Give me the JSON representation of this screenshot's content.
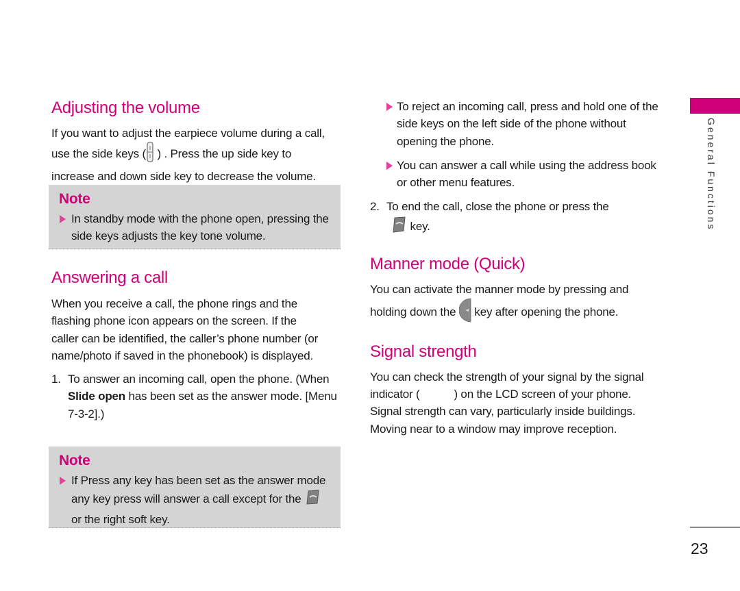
{
  "sections": {
    "volume": {
      "heading": "Adjusting the volume",
      "text_a": "If you want to adjust the earpiece volume during a call, use the side keys (",
      "text_b": ") . Press the up side key to increase and down side key to decrease the volume.",
      "note": {
        "title": "Note",
        "bullet": "In standby mode with the phone open, pressing the side keys adjusts the key tone volume."
      }
    },
    "answering": {
      "heading": "Answering a call",
      "text": "When you receive a call, the phone rings and the flashing phone icon appears on the screen. If the caller can be identified, the caller’s phone number (or name/photo if saved in the phonebook) is displayed.",
      "step1": {
        "number": "1.",
        "text_a": "To answer an incoming call, open the phone. (When ",
        "bold": "Slide open",
        "text_b": " has been set as the answer mode. [Menu 7-3-2].)"
      },
      "note": {
        "title": "Note",
        "bullet_a": "If Press any key has been set as the answer mode any key press will answer a call except for the ",
        "bullet_b": " or the right soft key."
      },
      "bullets": [
        "To reject an incoming call, press and hold one of the side keys on the left side of the phone without opening the phone.",
        "You can answer a call while using the address book or other menu features."
      ],
      "step2": {
        "number": "2.",
        "text_a": "To end the call, close the phone or press the",
        "text_b": "key."
      }
    },
    "manner": {
      "heading": "Manner mode (Quick)",
      "text_a": "You can activate the manner mode by pressing and holding down the ",
      "text_b": " key after opening the phone."
    },
    "signal": {
      "heading": "Signal strength",
      "text_a": "You can check the strength of your signal by the signal indicator (",
      "text_b": ") on the LCD screen of your phone. Signal strength can vary, particularly inside buildings. Moving near to a window may improve reception."
    }
  },
  "sidebar": {
    "chapter": "General Functions"
  },
  "footer": {
    "page_number": "23"
  },
  "colors": {
    "accent": "#d1007a",
    "note_bg": "#d4d4d4",
    "bullet": "#e8409a"
  }
}
